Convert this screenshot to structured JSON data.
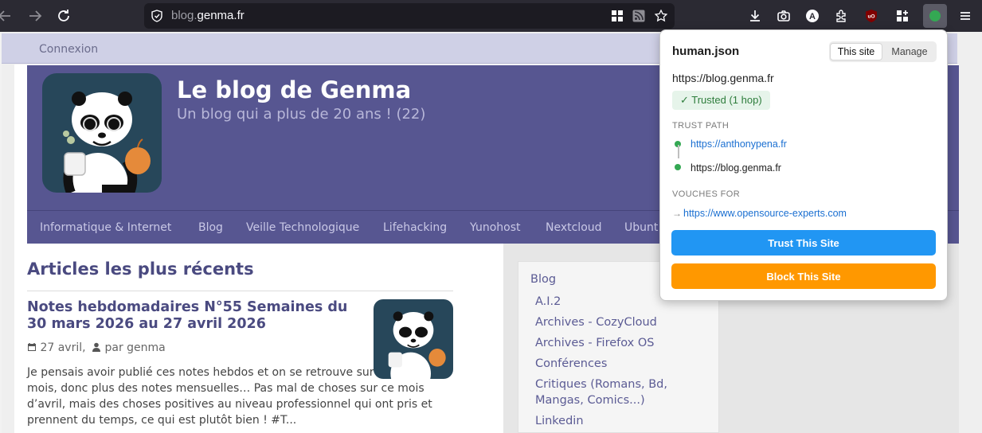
{
  "browser": {
    "url_domain": "blog.genma.fr",
    "url_prefix": "blog.",
    "url_main": "genma.fr"
  },
  "page": {
    "login_label": "Connexion",
    "site_title": "Le blog de Genma",
    "site_subtitle": "Un blog qui a plus de 20 ans ! (22)",
    "nav": [
      "Informatique & Internet",
      "Blog",
      "Veille Technologique",
      "Lifehacking",
      "Yunohost",
      "Nextcloud",
      "Ubunt"
    ],
    "section_title": "Articles les plus récents",
    "post": {
      "title": "Notes hebdomadaires N°55 Semaines du 30 mars 2026 au 27 avril 2026",
      "date": "27 avril,",
      "author": "par genma",
      "excerpt": "Je pensais avoir publié ces notes hebdos et on se retrouve sur un délai d’un mois, donc plus des notes mensuelles… Pas mal de choses sur ce mois d’avril, mais des choses positives au niveau professionnel qui ont pris et prennent du temps, ce qui est plutôt bien ! #T..."
    },
    "sidebar": {
      "heading": "Blog",
      "items": [
        "A.I.2",
        "Archives - CozyCloud",
        "Archives - Firefox OS",
        "Conférences",
        "Critiques (Romans, Bd, Mangas, Comics...)",
        "Linkedin"
      ]
    }
  },
  "popup": {
    "title": "human.json",
    "tab_this_site": "This site",
    "tab_manage": "Manage",
    "site_url": "https://blog.genma.fr",
    "badge": "✓ Trusted (1 hop)",
    "trust_path_label": "TRUST PATH",
    "trust_path": [
      "https://anthonypena.fr",
      "https://blog.genma.fr"
    ],
    "vouches_label": "VOUCHES FOR",
    "vouches": [
      "https://www.opensource-experts.com"
    ],
    "trust_button": "Trust This Site",
    "block_button": "Block This Site"
  },
  "colors": {
    "toolbar_bg": "#2b2a33",
    "header_bg": "#575691",
    "trust_button": "#2196f3",
    "block_button": "#ff9800",
    "trusted_green": "#34a853"
  }
}
